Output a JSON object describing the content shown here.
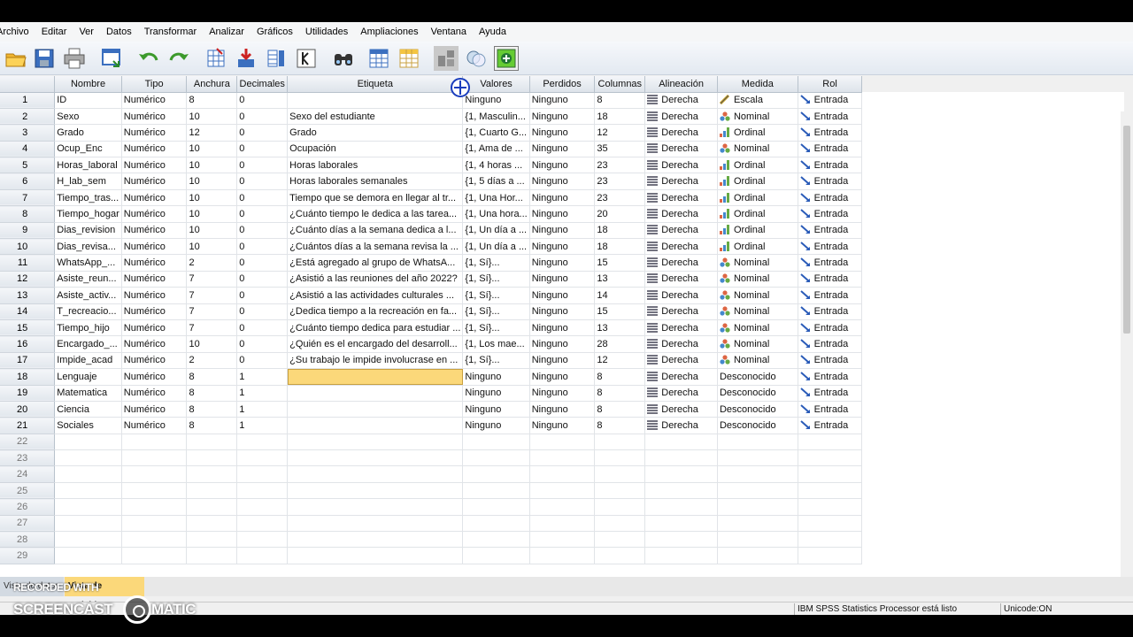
{
  "menus": [
    "Archivo",
    "Editar",
    "Ver",
    "Datos",
    "Transformar",
    "Analizar",
    "Gráficos",
    "Utilidades",
    "Ampliaciones",
    "Ventana",
    "Ayuda"
  ],
  "toolbar_icons": [
    "open-icon",
    "save-icon",
    "print-icon",
    "dialog-recall-icon",
    "undo-icon",
    "redo-icon",
    "goto-case-icon",
    "goto-variable-icon",
    "variables-icon",
    "run-descriptives-icon",
    "find-icon",
    "insert-cases-icon",
    "insert-variable-icon",
    "split-file-icon",
    "select-cases-icon",
    "value-labels-icon"
  ],
  "columns": [
    "Nombre",
    "Tipo",
    "Anchura",
    "Decimales",
    "Etiqueta",
    "Valores",
    "Perdidos",
    "Columnas",
    "Alineación",
    "Medida",
    "Rol"
  ],
  "rows": [
    {
      "n": "1",
      "nombre": "ID",
      "tipo": "Numérico",
      "anchura": "8",
      "decimales": "0",
      "etiqueta": "",
      "valores": "Ninguno",
      "perdidos": "Ninguno",
      "columnas": "8",
      "alineacion": "Derecha",
      "medida": "Escala",
      "medida_icon": "scale",
      "rol": "Entrada"
    },
    {
      "n": "2",
      "nombre": "Sexo",
      "tipo": "Numérico",
      "anchura": "10",
      "decimales": "0",
      "etiqueta": "Sexo del estudiante",
      "valores": "{1, Masculin...",
      "perdidos": "Ninguno",
      "columnas": "18",
      "alineacion": "Derecha",
      "medida": "Nominal",
      "medida_icon": "nominal",
      "rol": "Entrada"
    },
    {
      "n": "3",
      "nombre": "Grado",
      "tipo": "Numérico",
      "anchura": "12",
      "decimales": "0",
      "etiqueta": "Grado",
      "valores": "{1, Cuarto G...",
      "perdidos": "Ninguno",
      "columnas": "12",
      "alineacion": "Derecha",
      "medida": "Ordinal",
      "medida_icon": "ordinal",
      "rol": "Entrada"
    },
    {
      "n": "4",
      "nombre": "Ocup_Enc",
      "tipo": "Numérico",
      "anchura": "10",
      "decimales": "0",
      "etiqueta": "Ocupación",
      "valores": "{1, Ama de ...",
      "perdidos": "Ninguno",
      "columnas": "35",
      "alineacion": "Derecha",
      "medida": "Nominal",
      "medida_icon": "nominal",
      "rol": "Entrada"
    },
    {
      "n": "5",
      "nombre": "Horas_laboral",
      "tipo": "Numérico",
      "anchura": "10",
      "decimales": "0",
      "etiqueta": "Horas laborales",
      "valores": "{1, 4 horas ...",
      "perdidos": "Ninguno",
      "columnas": "23",
      "alineacion": "Derecha",
      "medida": "Ordinal",
      "medida_icon": "ordinal",
      "rol": "Entrada"
    },
    {
      "n": "6",
      "nombre": "H_lab_sem",
      "tipo": "Numérico",
      "anchura": "10",
      "decimales": "0",
      "etiqueta": "Horas laborales semanales",
      "valores": "{1, 5 días a ...",
      "perdidos": "Ninguno",
      "columnas": "23",
      "alineacion": "Derecha",
      "medida": "Ordinal",
      "medida_icon": "ordinal",
      "rol": "Entrada"
    },
    {
      "n": "7",
      "nombre": "Tiempo_tras...",
      "tipo": "Numérico",
      "anchura": "10",
      "decimales": "0",
      "etiqueta": "Tiempo que se demora en llegar al tr...",
      "valores": "{1, Una Hor...",
      "perdidos": "Ninguno",
      "columnas": "23",
      "alineacion": "Derecha",
      "medida": "Ordinal",
      "medida_icon": "ordinal",
      "rol": "Entrada"
    },
    {
      "n": "8",
      "nombre": "Tiempo_hogar",
      "tipo": "Numérico",
      "anchura": "10",
      "decimales": "0",
      "etiqueta": "¿Cuánto tiempo le dedica a las tarea...",
      "valores": "{1, Una hora...",
      "perdidos": "Ninguno",
      "columnas": "20",
      "alineacion": "Derecha",
      "medida": "Ordinal",
      "medida_icon": "ordinal",
      "rol": "Entrada"
    },
    {
      "n": "9",
      "nombre": "Dias_revision",
      "tipo": "Numérico",
      "anchura": "10",
      "decimales": "0",
      "etiqueta": "¿Cuánto días a la semana dedica a l...",
      "valores": "{1, Un día a ...",
      "perdidos": "Ninguno",
      "columnas": "18",
      "alineacion": "Derecha",
      "medida": "Ordinal",
      "medida_icon": "ordinal",
      "rol": "Entrada"
    },
    {
      "n": "10",
      "nombre": "Dias_revisa...",
      "tipo": "Numérico",
      "anchura": "10",
      "decimales": "0",
      "etiqueta": "¿Cuántos días a la semana revisa la ...",
      "valores": "{1, Un día a ...",
      "perdidos": "Ninguno",
      "columnas": "18",
      "alineacion": "Derecha",
      "medida": "Ordinal",
      "medida_icon": "ordinal",
      "rol": "Entrada"
    },
    {
      "n": "11",
      "nombre": "WhatsApp_...",
      "tipo": "Numérico",
      "anchura": "2",
      "decimales": "0",
      "etiqueta": "¿Está agregado al grupo de WhatsA...",
      "valores": "{1, Sí}...",
      "perdidos": "Ninguno",
      "columnas": "15",
      "alineacion": "Derecha",
      "medida": "Nominal",
      "medida_icon": "nominal",
      "rol": "Entrada"
    },
    {
      "n": "12",
      "nombre": "Asiste_reun...",
      "tipo": "Numérico",
      "anchura": "7",
      "decimales": "0",
      "etiqueta": "¿Asistió a las reuniones del año 2022?",
      "valores": "{1, Sí}...",
      "perdidos": "Ninguno",
      "columnas": "13",
      "alineacion": "Derecha",
      "medida": "Nominal",
      "medida_icon": "nominal",
      "rol": "Entrada"
    },
    {
      "n": "13",
      "nombre": "Asiste_activ...",
      "tipo": "Numérico",
      "anchura": "7",
      "decimales": "0",
      "etiqueta": "¿Asistió a las actividades culturales ...",
      "valores": "{1, Sí}...",
      "perdidos": "Ninguno",
      "columnas": "14",
      "alineacion": "Derecha",
      "medida": "Nominal",
      "medida_icon": "nominal",
      "rol": "Entrada"
    },
    {
      "n": "14",
      "nombre": "T_recreacio...",
      "tipo": "Numérico",
      "anchura": "7",
      "decimales": "0",
      "etiqueta": "¿Dedica tiempo a la recreación en fa...",
      "valores": "{1, Sí}...",
      "perdidos": "Ninguno",
      "columnas": "15",
      "alineacion": "Derecha",
      "medida": "Nominal",
      "medida_icon": "nominal",
      "rol": "Entrada"
    },
    {
      "n": "15",
      "nombre": "Tiempo_hijo",
      "tipo": "Numérico",
      "anchura": "7",
      "decimales": "0",
      "etiqueta": "¿Cuánto tiempo dedica para estudiar ...",
      "valores": "{1, Sí}...",
      "perdidos": "Ninguno",
      "columnas": "13",
      "alineacion": "Derecha",
      "medida": "Nominal",
      "medida_icon": "nominal",
      "rol": "Entrada"
    },
    {
      "n": "16",
      "nombre": "Encargado_...",
      "tipo": "Numérico",
      "anchura": "10",
      "decimales": "0",
      "etiqueta": "¿Quién es el encargado del desarroll...",
      "valores": "{1, Los mae...",
      "perdidos": "Ninguno",
      "columnas": "28",
      "alineacion": "Derecha",
      "medida": "Nominal",
      "medida_icon": "nominal",
      "rol": "Entrada"
    },
    {
      "n": "17",
      "nombre": "Impide_acad",
      "tipo": "Numérico",
      "anchura": "2",
      "decimales": "0",
      "etiqueta": "¿Su trabajo le impide involucrase en ...",
      "valores": "{1, Sí}...",
      "perdidos": "Ninguno",
      "columnas": "12",
      "alineacion": "Derecha",
      "medida": "Nominal",
      "medida_icon": "nominal",
      "rol": "Entrada"
    },
    {
      "n": "18",
      "nombre": "Lenguaje",
      "tipo": "Numérico",
      "anchura": "8",
      "decimales": "1",
      "etiqueta": "",
      "valores": "Ninguno",
      "perdidos": "Ninguno",
      "columnas": "8",
      "alineacion": "Derecha",
      "medida": "Desconocido",
      "medida_icon": "",
      "rol": "Entrada",
      "active": true
    },
    {
      "n": "19",
      "nombre": "Matematica",
      "tipo": "Numérico",
      "anchura": "8",
      "decimales": "1",
      "etiqueta": "",
      "valores": "Ninguno",
      "perdidos": "Ninguno",
      "columnas": "8",
      "alineacion": "Derecha",
      "medida": "Desconocido",
      "medida_icon": "",
      "rol": "Entrada"
    },
    {
      "n": "20",
      "nombre": "Ciencia",
      "tipo": "Numérico",
      "anchura": "8",
      "decimales": "1",
      "etiqueta": "",
      "valores": "Ninguno",
      "perdidos": "Ninguno",
      "columnas": "8",
      "alineacion": "Derecha",
      "medida": "Desconocido",
      "medida_icon": "",
      "rol": "Entrada"
    },
    {
      "n": "21",
      "nombre": "Sociales",
      "tipo": "Numérico",
      "anchura": "8",
      "decimales": "1",
      "etiqueta": "",
      "valores": "Ninguno",
      "perdidos": "Ninguno",
      "columnas": "8",
      "alineacion": "Derecha",
      "medida": "Desconocido",
      "medida_icon": "",
      "rol": "Entrada"
    }
  ],
  "empty_rows": [
    "22",
    "23",
    "24",
    "25",
    "26",
    "27",
    "28",
    "29"
  ],
  "tabs": {
    "data_view": "Vista de datos",
    "variable_view": "Vista de variables"
  },
  "status": {
    "processor": "IBM SPSS Statistics Processor está listo",
    "encoding": "Unicode:ON"
  },
  "watermark": {
    "line1": "RECORDED WITH",
    "line2": "SCREENCAST",
    "line3": "MATIC"
  },
  "colors": {
    "active_cell": "#fbd87a",
    "header_bg": "#dde3ea"
  }
}
